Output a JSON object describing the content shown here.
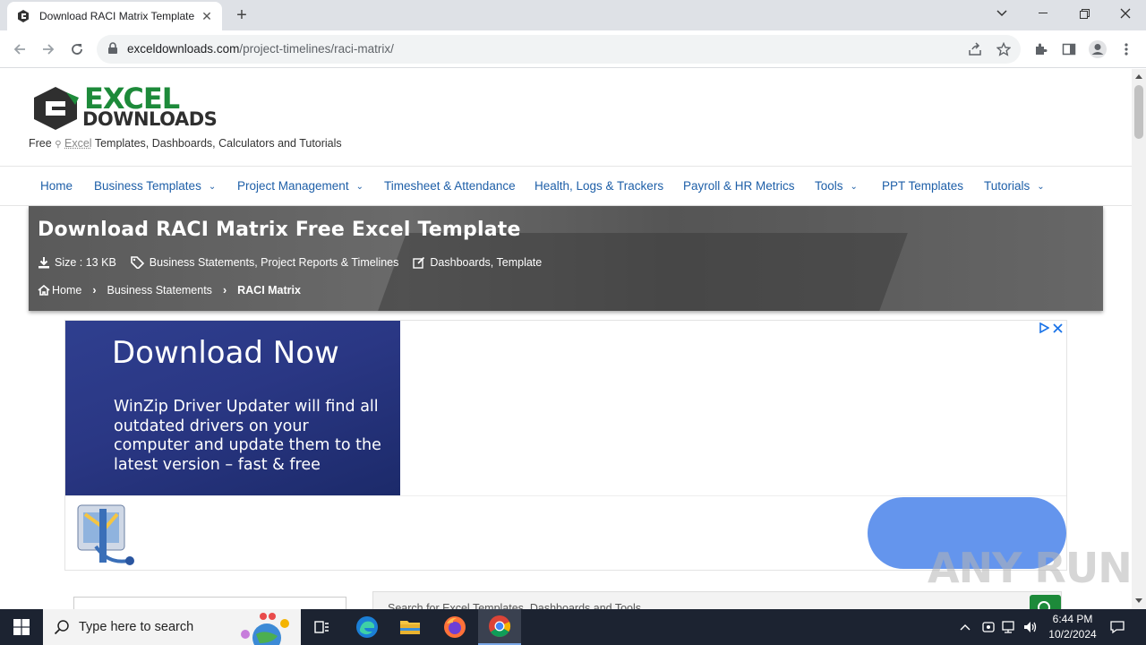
{
  "browser": {
    "tab_title": "Download RACI Matrix Template",
    "url_host": "exceldownloads.com",
    "url_path": "/project-timelines/raci-matrix/"
  },
  "site": {
    "logo_line1": "EXCEL",
    "logo_line2": "DOWNLOADS",
    "tagline_pre": "Free",
    "tagline_excel": "Excel",
    "tagline_post": "Templates, Dashboards, Calculators and Tutorials",
    "nav": [
      {
        "label": "Home",
        "dropdown": false
      },
      {
        "label": "Business Templates",
        "dropdown": true
      },
      {
        "label": "Project Management",
        "dropdown": true
      },
      {
        "label": "Timesheet & Attendance",
        "dropdown": false
      },
      {
        "label": "Health, Logs & Trackers",
        "dropdown": false
      },
      {
        "label": "Payroll & HR Metrics",
        "dropdown": false
      },
      {
        "label": "Tools",
        "dropdown": true
      },
      {
        "label": "PPT Templates",
        "dropdown": false
      },
      {
        "label": "Tutorials",
        "dropdown": true
      }
    ]
  },
  "hero": {
    "title": "Download RACI Matrix Free Excel Template",
    "size": "Size : 13 KB",
    "categories": "Business Statements, Project Reports & Timelines",
    "tags": "Dashboards, Template",
    "breadcrumb": [
      "Home",
      "Business Statements",
      "RACI Matrix"
    ]
  },
  "ad": {
    "headline": "Download Now",
    "body": "WinZip Driver Updater will find all outdated drivers on your computer and update them to the latest version – fast & free"
  },
  "search": {
    "placeholder": "Search for Excel Templates, Dashboards and Tools"
  },
  "watermark": "ANY RUN",
  "taskbar": {
    "search_placeholder": "Type here to search",
    "time": "6:44 PM",
    "date": "10/2/2024"
  },
  "colors": {
    "nav_link": "#1e5fa8",
    "ad_background": "#2a3784",
    "ad_button": "#6495ed",
    "search_button": "#1d8a3a",
    "taskbar": "#1c2331"
  }
}
